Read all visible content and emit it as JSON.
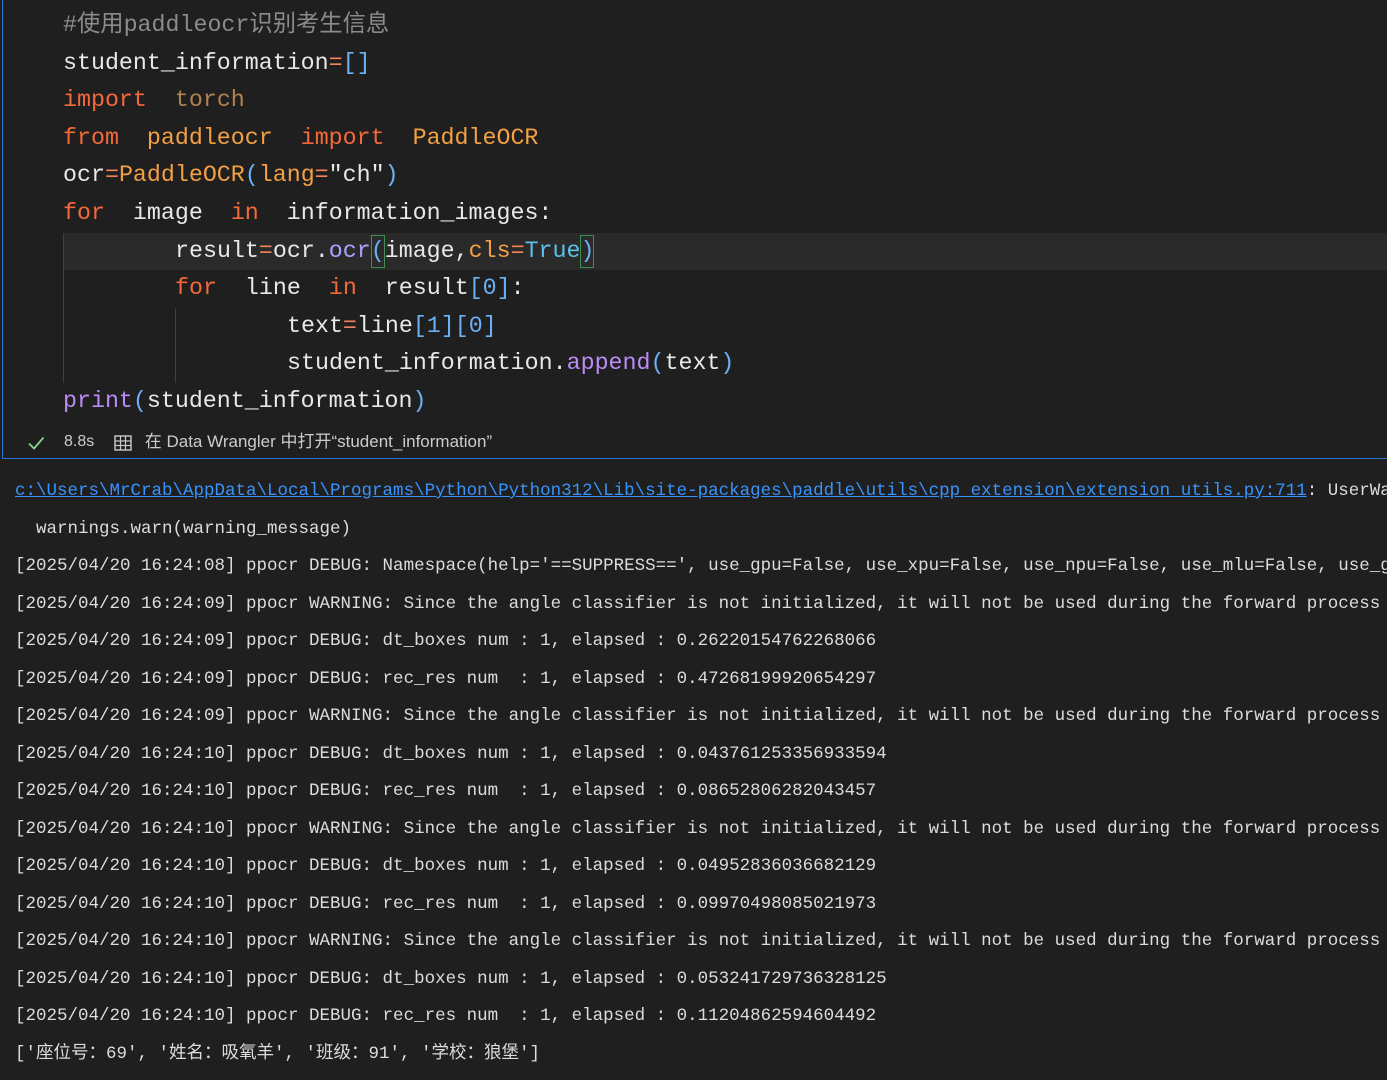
{
  "theme": {
    "background": "#1f1f1f",
    "cell_border": "#2a78d4",
    "active_line": "#2a2a2a",
    "indent_guide": "#404040",
    "bracket_match": "#3e8f52",
    "output_text": "#dcdcdc",
    "link": "#3794ff",
    "status_text": "#cccccc",
    "success": "#89d185",
    "syntax": {
      "comment": "#8b8b8b",
      "plain": "#e8e8e8",
      "keyword": "#f5683a",
      "unused": "#b08250",
      "module": "#f3a045",
      "class": "#f3a045",
      "op": "#f2845a",
      "bracket": "#6cb0f5",
      "param": "#f3a045",
      "string": "#e8e8e8",
      "method": "#a9a3ff",
      "function": "#bb8cf5",
      "const": "#5cc0e8"
    }
  },
  "code": {
    "lines": [
      {
        "indent": 0,
        "tokens": [
          [
            "#使用paddleocr识别考生信息",
            "comment"
          ]
        ]
      },
      {
        "indent": 0,
        "tokens": [
          [
            "student_information",
            "plain"
          ],
          [
            "=",
            "op"
          ],
          [
            "[]",
            "bracket"
          ]
        ]
      },
      {
        "indent": 0,
        "tokens": [
          [
            "import",
            "keyword"
          ],
          [
            " ",
            "plain"
          ],
          [
            "torch",
            "unused"
          ]
        ]
      },
      {
        "indent": 0,
        "tokens": [
          [
            "from",
            "keyword"
          ],
          [
            " ",
            "plain"
          ],
          [
            "paddleocr",
            "module"
          ],
          [
            " ",
            "plain"
          ],
          [
            "import",
            "keyword"
          ],
          [
            " ",
            "plain"
          ],
          [
            "PaddleOCR",
            "class"
          ]
        ]
      },
      {
        "indent": 0,
        "tokens": [
          [
            "ocr",
            "plain"
          ],
          [
            "=",
            "op"
          ],
          [
            "PaddleOCR",
            "class"
          ],
          [
            "(",
            "bracket"
          ],
          [
            "lang",
            "param"
          ],
          [
            "=",
            "op"
          ],
          [
            "\"ch\"",
            "string"
          ],
          [
            ")",
            "bracket"
          ]
        ]
      },
      {
        "indent": 0,
        "tokens": [
          [
            "for",
            "keyword"
          ],
          [
            " image ",
            "plain"
          ],
          [
            "in",
            "keyword"
          ],
          [
            " information_images:",
            "plain"
          ]
        ]
      },
      {
        "indent": 1,
        "active": true,
        "tokens": [
          [
            "result",
            "plain"
          ],
          [
            "=",
            "op"
          ],
          [
            "ocr.",
            "plain"
          ],
          [
            "ocr",
            "method"
          ],
          [
            "(",
            "bracket",
            "match"
          ],
          [
            "image,",
            "plain"
          ],
          [
            "cls",
            "param"
          ],
          [
            "=",
            "op"
          ],
          [
            "True",
            "const"
          ],
          [
            ")",
            "bracket",
            "match"
          ]
        ]
      },
      {
        "indent": 1,
        "tokens": [
          [
            "for",
            "keyword"
          ],
          [
            " line ",
            "plain"
          ],
          [
            "in",
            "keyword"
          ],
          [
            " result",
            "plain"
          ],
          [
            "[0]",
            "bracket"
          ],
          [
            ":",
            "plain"
          ]
        ]
      },
      {
        "indent": 2,
        "tokens": [
          [
            "text",
            "plain"
          ],
          [
            "=",
            "op"
          ],
          [
            "line",
            "plain"
          ],
          [
            "[1][0]",
            "bracket"
          ]
        ]
      },
      {
        "indent": 2,
        "tokens": [
          [
            "student_information.",
            "plain"
          ],
          [
            "append",
            "function"
          ],
          [
            "(",
            "bracket"
          ],
          [
            "text",
            "plain"
          ],
          [
            ")",
            "bracket"
          ]
        ]
      },
      {
        "indent": 0,
        "tokens": [
          [
            "print",
            "function"
          ],
          [
            "(",
            "bracket"
          ],
          [
            "student_information",
            "plain"
          ],
          [
            ")",
            "bracket"
          ]
        ]
      }
    ]
  },
  "status": {
    "success_icon": "check-icon",
    "duration": "8.8s",
    "open_icon": "data-wrangler-icon",
    "open_label": "在 Data Wrangler 中打开“student_information”"
  },
  "output": {
    "warning_link": "c:\\Users\\MrCrab\\AppData\\Local\\Programs\\Python\\Python312\\Lib\\site-packages\\paddle\\utils\\cpp_extension\\extension_utils.py:711",
    "warning_rest": ": UserWa",
    "lines": [
      "  warnings.warn(warning_message)",
      "[2025/04/20 16:24:08] ppocr DEBUG: Namespace(help='==SUPPRESS==', use_gpu=False, use_xpu=False, use_npu=False, use_mlu=False, use_g",
      "[2025/04/20 16:24:09] ppocr WARNING: Since the angle classifier is not initialized, it will not be used during the forward process",
      "[2025/04/20 16:24:09] ppocr DEBUG: dt_boxes num : 1, elapsed : 0.26220154762268066",
      "[2025/04/20 16:24:09] ppocr DEBUG: rec_res num  : 1, elapsed : 0.47268199920654297",
      "[2025/04/20 16:24:09] ppocr WARNING: Since the angle classifier is not initialized, it will not be used during the forward process",
      "[2025/04/20 16:24:10] ppocr DEBUG: dt_boxes num : 1, elapsed : 0.043761253356933594",
      "[2025/04/20 16:24:10] ppocr DEBUG: rec_res num  : 1, elapsed : 0.08652806282043457",
      "[2025/04/20 16:24:10] ppocr WARNING: Since the angle classifier is not initialized, it will not be used during the forward process",
      "[2025/04/20 16:24:10] ppocr DEBUG: dt_boxes num : 1, elapsed : 0.04952836036682129",
      "[2025/04/20 16:24:10] ppocr DEBUG: rec_res num  : 1, elapsed : 0.09970498085021973",
      "[2025/04/20 16:24:10] ppocr WARNING: Since the angle classifier is not initialized, it will not be used during the forward process",
      "[2025/04/20 16:24:10] ppocr DEBUG: dt_boxes num : 1, elapsed : 0.053241729736328125",
      "[2025/04/20 16:24:10] ppocr DEBUG: rec_res num  : 1, elapsed : 0.11204862594604492",
      "['座位号：69', '姓名：吸氧羊', '班级：91', '学校：狼堡']"
    ]
  }
}
